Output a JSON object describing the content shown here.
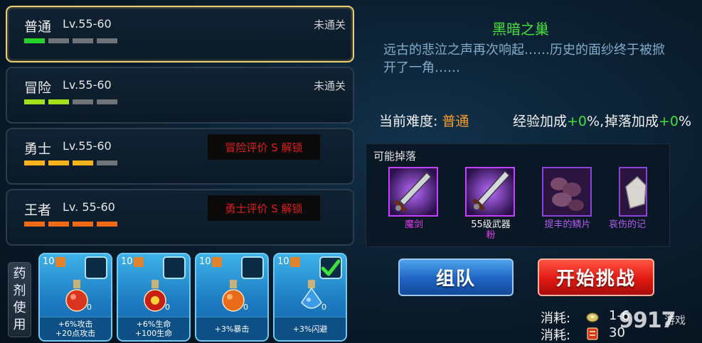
{
  "difficulties": [
    {
      "name": "普通",
      "level": "Lv.55-60",
      "status": "未通关",
      "lock_text": "",
      "bars": [
        "#27d22b",
        "#6f7478",
        "#6f7478",
        "#6f7478"
      ]
    },
    {
      "name": "冒险",
      "level": "Lv.55-60",
      "status": "未通关",
      "lock_text": "",
      "bars": [
        "#a5e01b",
        "#a5e01b",
        "#6f7478",
        "#6f7478"
      ]
    },
    {
      "name": "勇士",
      "level": "Lv.55-60",
      "status": "",
      "lock_text": "冒险评价 S 解锁",
      "bars": [
        "#ffb31a",
        "#ffb31a",
        "#ffb31a",
        "#6f7478"
      ]
    },
    {
      "name": "王者",
      "level": "Lv. 55-60",
      "status": "",
      "lock_text": "勇士评价 S 解锁",
      "bars": [
        "#f56a17",
        "#f56a17",
        "#f56a17",
        "#f56a17"
      ]
    }
  ],
  "potions": {
    "label": "药剂使用",
    "items": [
      {
        "count": "10",
        "qty": "0",
        "desc_line1": "+6%攻击",
        "desc_line2": "+20点攻击",
        "checked": false,
        "flask_color": "#d8341e"
      },
      {
        "count": "10",
        "qty": "0",
        "desc_line1": "+6%生命",
        "desc_line2": "+100生命",
        "checked": false,
        "flask_color": "#c81e14"
      },
      {
        "count": "10",
        "qty": "0",
        "desc_line1": "+3%暴击",
        "desc_line2": "",
        "checked": false,
        "flask_color": "#e86b1c"
      },
      {
        "count": "10",
        "qty": "0",
        "desc_line1": "+3%闪避",
        "desc_line2": "",
        "checked": true,
        "flask_color": "#3f9be8"
      }
    ]
  },
  "dungeon": {
    "title": "黑暗之巢",
    "description": "远古的悲泣之声再次响起……历史的面纱终于被掀开了一角……"
  },
  "info": {
    "difficulty_label": "当前难度:",
    "difficulty_value": "普通",
    "exp_label": "经验加成",
    "exp_value": "+0",
    "exp_suffix": "%,",
    "drop_label": "掉落加成",
    "drop_value": "+0",
    "drop_suffix": "%"
  },
  "drops": {
    "title": "可能掉落",
    "items": [
      {
        "name": "魔剑",
        "name2": "",
        "name_color": "#e43df0",
        "icon": "dark-sword-icon"
      },
      {
        "name": "55级武器",
        "name2": "粉",
        "name_color": "#f2f2f2",
        "name2_color": "#e43df0",
        "icon": "weapon-icon"
      },
      {
        "name": "提丰的鳞片",
        "name2": "",
        "name_color": "#b45cf0",
        "icon": "scale-icon"
      },
      {
        "name": "哀伤的记",
        "name2": "",
        "name_color": "#b45cf0",
        "icon": "crystal-icon"
      }
    ]
  },
  "buttons": {
    "team": "组队",
    "start": "开始挑战"
  },
  "costs": [
    {
      "label": "消耗:",
      "value": "1-6",
      "icon": "stamina-icon"
    },
    {
      "label": "消耗:",
      "value": "30",
      "icon": "ticket-icon"
    }
  ],
  "watermark": {
    "main": "9917",
    "sub": "游戏"
  }
}
